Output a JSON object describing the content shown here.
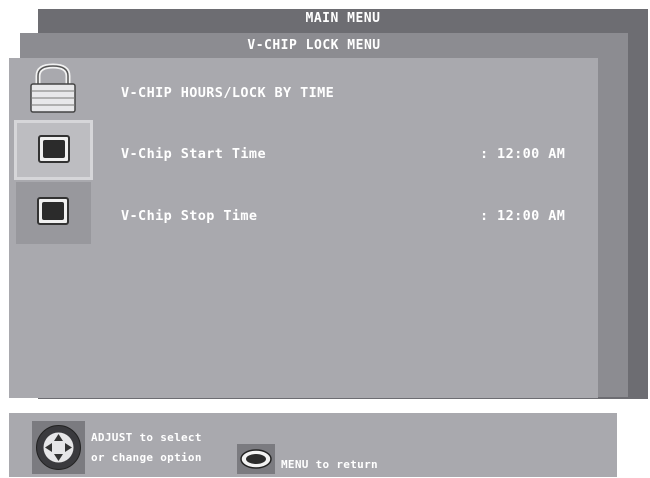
{
  "menu": {
    "main_title": "MAIN MENU",
    "sub_title": "V-CHIP LOCK MENU"
  },
  "rows": {
    "header": "V-CHIP HOURS/LOCK BY TIME",
    "start_label": "V-Chip Start Time",
    "start_value": ": 12:00 AM",
    "stop_label": "V-Chip Stop Time",
    "stop_value": ": 12:00 AM"
  },
  "footer": {
    "adjust_line1": "ADJUST to select",
    "adjust_line2": "or change option",
    "menu_text": "MENU to return"
  },
  "icons": {
    "lock": "padlock-icon",
    "start": "tv-screen-icon",
    "stop": "tv-screen-icon",
    "adjust": "dpad-icon",
    "menu": "menu-button-icon"
  },
  "colors": {
    "main_panel": "#6d6d72",
    "sub_panel": "#8c8c91",
    "content_panel": "#a9a9ae",
    "text": "#ffffff"
  }
}
